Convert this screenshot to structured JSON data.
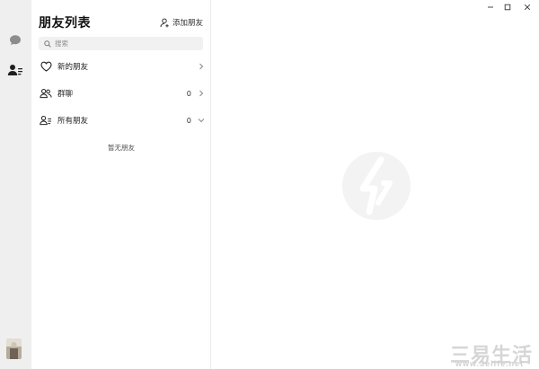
{
  "sidebar": {
    "items": [
      {
        "name": "chat",
        "icon": "chat-bubble-icon"
      },
      {
        "name": "friends",
        "icon": "contacts-icon",
        "active": true
      }
    ],
    "avatar_colors": [
      "#b7ab9c",
      "#6e6257",
      "#e3ddd4"
    ]
  },
  "friend_panel": {
    "title": "朋友列表",
    "add_friend_label": "添加朋友",
    "add_friend_icon": "add-person-icon",
    "search": {
      "placeholder": "搜索",
      "value": "",
      "icon": "search-icon"
    },
    "rows": [
      {
        "label": "新的朋友",
        "icon": "heart-icon",
        "count": "",
        "chevron": "chevron-right-icon"
      },
      {
        "label": "群聊",
        "icon": "group-icon",
        "count": "0",
        "chevron": "chevron-right-icon"
      },
      {
        "label": "所有朋友",
        "icon": "contacts-icon",
        "count": "0",
        "chevron": "chevron-down-icon"
      }
    ],
    "empty_text": "暂无朋友"
  },
  "main": {
    "placeholder_icon": "lightning-logo-icon",
    "window_controls": [
      "minimize-icon",
      "maximize-icon",
      "close-icon"
    ]
  },
  "watermark": {
    "text": "三易生活",
    "url": "www.3elife.net"
  },
  "colors": {
    "rail_bg": "#efefef",
    "panel_bg": "#ffffff",
    "search_bg": "#f1f1f1",
    "logo_gray": "#f3f3f3"
  }
}
